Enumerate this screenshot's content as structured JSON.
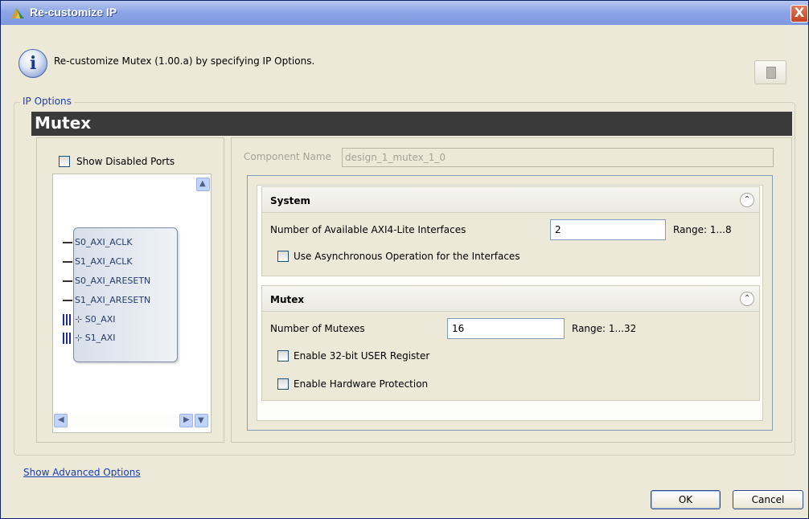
{
  "window": {
    "title": "Re-customize IP",
    "close_label": "X"
  },
  "header": {
    "description": "Re-customize Mutex (1.00.a) by specifying IP Options.",
    "info_icon": "info-icon",
    "doc_icon": "document-icon"
  },
  "ip_options": {
    "group_label": "IP Options",
    "ip_name": "Mutex"
  },
  "left_panel": {
    "show_disabled_ports": {
      "label": "Show Disabled Ports",
      "checked": false
    },
    "ports": [
      {
        "name": "S0_AXI_ACLK",
        "kind": "signal"
      },
      {
        "name": "S1_AXI_ACLK",
        "kind": "signal"
      },
      {
        "name": "S0_AXI_ARESETN",
        "kind": "signal"
      },
      {
        "name": "S1_AXI_ARESETN",
        "kind": "signal"
      },
      {
        "name": "S0_AXI",
        "kind": "bus"
      },
      {
        "name": "S1_AXI",
        "kind": "bus"
      }
    ]
  },
  "component": {
    "label": "Component Name",
    "value": "design_1_mutex_1_0"
  },
  "system": {
    "title": "System",
    "interfaces_label": "Number of Available AXI4-Lite Interfaces",
    "interfaces_value": "2",
    "interfaces_range": "Range: 1...8",
    "async": {
      "label": "Use Asynchronous Operation for the Interfaces",
      "checked": false
    }
  },
  "mutex": {
    "title": "Mutex",
    "count_label": "Number of Mutexes",
    "count_value": "16",
    "count_range": "Range: 1...32",
    "user_reg": {
      "label": "Enable 32-bit USER Register",
      "checked": false
    },
    "hw_protect": {
      "label": "Enable Hardware Protection",
      "checked": false
    }
  },
  "footer": {
    "advanced_link": "Show Advanced Options",
    "ok_label": "OK",
    "cancel_label": "Cancel"
  }
}
